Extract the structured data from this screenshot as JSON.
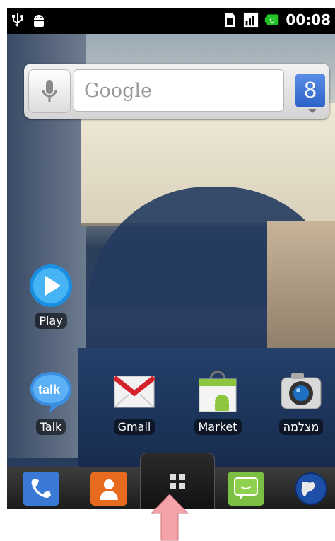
{
  "status_bar": {
    "time": "00:08",
    "icons": [
      "usb-icon",
      "android-debug-icon",
      "sim-icon",
      "signal-icon",
      "battery-icon"
    ]
  },
  "search_widget": {
    "placeholder": "Google",
    "search_button_glyph": "8",
    "icons": [
      "microphone-icon"
    ]
  },
  "apps": [
    {
      "label": "Play",
      "icon": "play-icon"
    },
    {
      "label": "Talk",
      "icon": "talk-icon",
      "icon_text": "talk"
    },
    {
      "label": "Gmail",
      "icon": "gmail-icon"
    },
    {
      "label": "Market",
      "icon": "market-icon"
    },
    {
      "label": "מצלמה",
      "icon": "camera-icon"
    }
  ],
  "dock": {
    "items": [
      "phone-icon",
      "contacts-icon",
      "app-drawer-icon",
      "messaging-icon",
      "browser-icon"
    ]
  },
  "annotation": {
    "icon": "pink-arrow-icon"
  },
  "colors": {
    "arrow": "#f4a3a8",
    "status_bar": "#000000",
    "search_button": "#2c62c9"
  }
}
